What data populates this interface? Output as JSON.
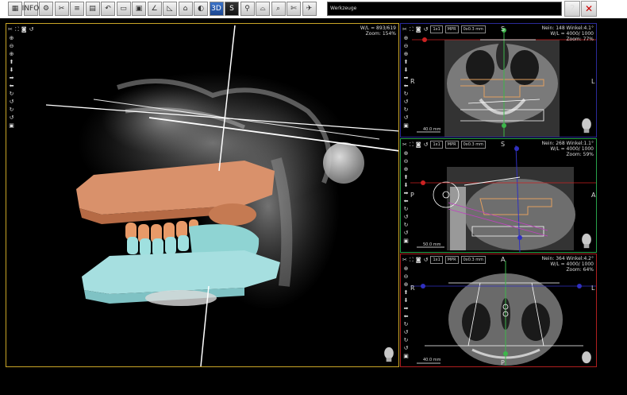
{
  "toolbar": {
    "buttons": [
      {
        "name": "layout-icon",
        "glyph": "▦"
      },
      {
        "name": "info-icon",
        "glyph": "INFO"
      },
      {
        "name": "settings-icon",
        "glyph": "⚙"
      },
      {
        "name": "tools-icon",
        "glyph": "✂"
      },
      {
        "name": "ruler-icon",
        "glyph": "≡"
      },
      {
        "name": "save-icon",
        "glyph": "▤"
      },
      {
        "name": "undo-icon",
        "glyph": "↶"
      },
      {
        "name": "window-icon",
        "glyph": "▭"
      },
      {
        "name": "monitor-icon",
        "glyph": "▣"
      },
      {
        "name": "angle-icon",
        "glyph": "∠"
      },
      {
        "name": "measure-icon",
        "glyph": "◺"
      },
      {
        "name": "cube-icon",
        "glyph": "⌂"
      },
      {
        "name": "contrast-icon",
        "glyph": "◐"
      },
      {
        "name": "3d-icon",
        "glyph": "3D",
        "style": "blue"
      },
      {
        "name": "slice-icon",
        "glyph": "S",
        "style": "dark"
      },
      {
        "name": "implant-icon",
        "glyph": "⚲"
      },
      {
        "name": "panorama-icon",
        "glyph": "⌓"
      },
      {
        "name": "zoom-tool-icon",
        "glyph": "⌕"
      },
      {
        "name": "segment-icon",
        "glyph": "✄"
      },
      {
        "name": "airway-icon",
        "glyph": "✈"
      }
    ],
    "tool_label": "Werkzeuge",
    "help_label": "?",
    "close_label": "✕"
  },
  "main_view": {
    "wl": "W/L = 893/619",
    "zoom": "Zoom: 154%"
  },
  "coronal_view": {
    "header": [
      "1x1",
      "MPR",
      "0x0.3 mm"
    ],
    "info": [
      "Nein: 148 Winkel:4.1°",
      "W/L = 4000/ 1000",
      "Zoom: 77%"
    ],
    "orient": {
      "top": "S",
      "left": "R",
      "right": "L"
    },
    "scale": "40.0 mm"
  },
  "sagittal_view": {
    "header": [
      "1x1",
      "MPR",
      "0x0.3 mm"
    ],
    "info": [
      "Nein: 268 Winkel:1.1°",
      "W/L = 4000/ 1000",
      "Zoom: 59%"
    ],
    "orient": {
      "top": "S",
      "left": "P",
      "right": "A"
    },
    "scale": "50.0 mm"
  },
  "axial_view": {
    "header": [
      "1x1",
      "MPR",
      "0x0.3 mm"
    ],
    "info": [
      "Nein: 364 Winkel:4.2°",
      "W/L = 4000/ 1000",
      "Zoom: 64%"
    ],
    "orient": {
      "top": "A",
      "left": "R",
      "right": "L",
      "bottom": "P"
    },
    "scale": "40.0 mm"
  },
  "view_tools": {
    "vertical": [
      "⊕",
      "⊖",
      "⊕",
      "⬆",
      "⬇",
      "➡",
      "⬅",
      "↻",
      "↺",
      "↻",
      "↺",
      "▣"
    ],
    "horizontal": [
      "✂",
      "⛶",
      "◙",
      "↺"
    ]
  },
  "colors": {
    "main_border": "#c9a527",
    "coronal_border": "#2b2b9a",
    "sagittal_border": "#27a34a",
    "axial_border": "#b01f1f"
  }
}
